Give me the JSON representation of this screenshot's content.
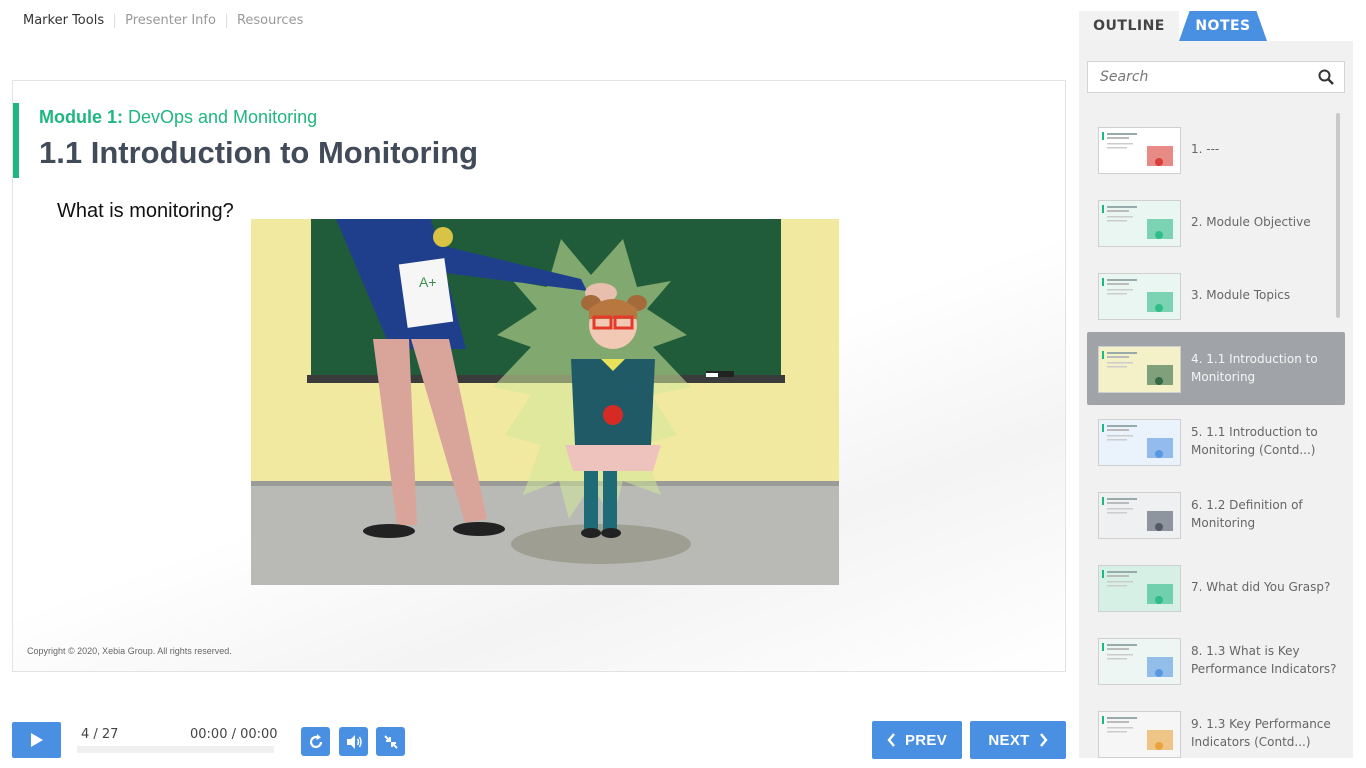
{
  "topnav": {
    "items": [
      "Marker Tools",
      "Presenter Info",
      "Resources"
    ]
  },
  "slide": {
    "module_prefix": "Module 1:",
    "module_name": " DevOps and Monitoring",
    "title": "1.1 Introduction to Monitoring",
    "question": "What is monitoring?",
    "copyright": "Copyright © 2020, Xebia Group. All rights reserved."
  },
  "controls": {
    "counter": "4 / 27",
    "time": "00:00 / 00:00",
    "progress": 0,
    "prev_label": "PREV",
    "next_label": "NEXT"
  },
  "sidebar": {
    "tab_outline": "OUTLINE",
    "tab_notes": "NOTES",
    "search_placeholder": "Search",
    "active_index": 3,
    "items": [
      "1. ---",
      "2. Module Objective",
      "3. Module Topics",
      "4. 1.1 Introduction to Monitoring",
      "5. 1.1 Introduction to Monitoring (Contd...)",
      "6. 1.2 Definition of Monitoring",
      "7. What did You Grasp?",
      "8. 1.3 What is Key Performance Indicators?",
      "9. 1.3 Key Performance Indicators (Contd...)"
    ]
  },
  "colors": {
    "accent_blue": "#4a90e2",
    "module_green": "#1fb77f",
    "title_slate": "#424b5a",
    "active_item_gray": "#a0a4a8"
  }
}
